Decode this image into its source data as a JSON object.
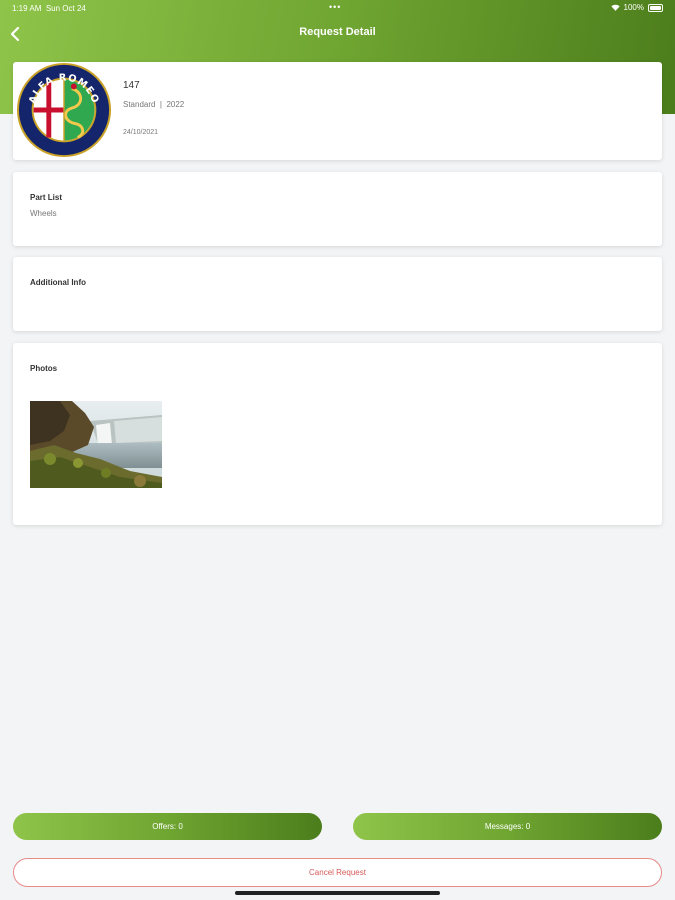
{
  "status_bar": {
    "time": "1:19 AM",
    "date": "Sun Oct 24",
    "center": "•••",
    "battery": "100%"
  },
  "header": {
    "title": "Request Detail",
    "back_icon": "chevron-left-icon"
  },
  "vehicle": {
    "model": "147",
    "trim": "Standard",
    "separator": "|",
    "year": "2022",
    "date": "24/10/2021",
    "logo_text": "ALFA ROMEO"
  },
  "part_list": {
    "title": "Part List",
    "value": "Wheels"
  },
  "additional_info": {
    "title": "Additional Info",
    "value": ""
  },
  "photos": {
    "title": "Photos",
    "items": [
      {
        "alt": "waterfall photo"
      }
    ]
  },
  "actions": {
    "offers_label": "Offers: 0",
    "messages_label": "Messages: 0",
    "cancel_label": "Cancel Request"
  },
  "colors": {
    "accent_light": "#8fc44a",
    "accent_dark": "#4c7d1c",
    "cancel": "#d85a5a"
  }
}
